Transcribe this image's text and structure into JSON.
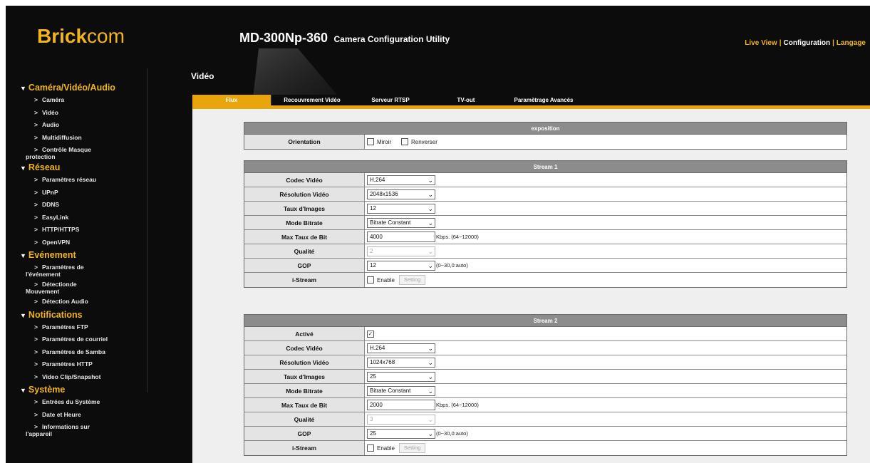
{
  "brand": {
    "logo_bold": "Brick",
    "logo_thin": "com",
    "accent": "#f2b51a"
  },
  "header": {
    "model": "MD-300Np-360",
    "subtitle": "Camera Configuration Utility",
    "nav": [
      {
        "label": "Live View",
        "active": false
      },
      {
        "label": "Configuration",
        "active": true
      },
      {
        "label": "Langage",
        "active": false
      }
    ]
  },
  "sidebar": {
    "sections": [
      {
        "title": "Caméra/Vidéo/Audio",
        "items": [
          {
            "label": "Caméra"
          },
          {
            "label": "Vidéo"
          },
          {
            "label": "Audio"
          },
          {
            "label": "Multidiffusion"
          },
          {
            "label": "Contrôle Masque",
            "cont": "protection"
          }
        ]
      },
      {
        "title": "Réseau",
        "items": [
          {
            "label": "Paramètres réseau"
          },
          {
            "label": "UPnP"
          },
          {
            "label": "DDNS"
          },
          {
            "label": "EasyLink"
          },
          {
            "label": "HTTP/HTTPS"
          },
          {
            "label": "OpenVPN"
          }
        ]
      },
      {
        "title": "Evénement",
        "items": [
          {
            "label": "Paramètres de",
            "cont": "l'événement"
          },
          {
            "label": "Détectionde",
            "cont": "Mouvement"
          },
          {
            "label": "Détection Audio"
          }
        ]
      },
      {
        "title": "Notifications",
        "items": [
          {
            "label": "Paramètres FTP"
          },
          {
            "label": "Paramètres de courriel"
          },
          {
            "label": "Paramètres de Samba"
          },
          {
            "label": "Paramètres HTTP"
          },
          {
            "label": "Video Clip/Snapshot"
          }
        ]
      },
      {
        "title": "Système",
        "items": [
          {
            "label": "Entrées du Système"
          },
          {
            "label": "Date et Heure"
          },
          {
            "label": "Informations sur",
            "cont": "l'appareil"
          }
        ]
      }
    ]
  },
  "main": {
    "title": "Vidéo",
    "tabs": [
      {
        "label": "Flux",
        "active": true
      },
      {
        "label": "Recouvrement Vidéo",
        "active": false
      },
      {
        "label": "Serveur RTSP",
        "active": false
      },
      {
        "label": "TV-out",
        "active": false
      },
      {
        "label": "Paramètrage Avancés",
        "active": false
      }
    ],
    "exposure": {
      "header": "exposition",
      "orientation_label": "Orientation",
      "mirror_label": "Miroir",
      "mirror_checked": false,
      "flip_label": "Renverser",
      "flip_checked": false
    },
    "stream1": {
      "header": "Stream 1",
      "codec_label": "Codec Vidéo",
      "codec": "H.264",
      "resolution_label": "Résolution Vidéo",
      "resolution": "2048x1536",
      "fps_label": "Taux d'Images",
      "fps": "12",
      "bitrate_mode_label": "Mode Bitrate",
      "bitrate_mode": "Bitrate Constant",
      "max_bitrate_label": "Max Taux de Bit",
      "max_bitrate": "4000",
      "max_bitrate_hint": "Kbps. (64~12000)",
      "quality_label": "Qualité",
      "quality": "2",
      "gop_label": "GOP",
      "gop": "12",
      "gop_hint": "(0~30,0:auto)",
      "istream_label": "i-Stream",
      "istream_enable_label": "Enable",
      "istream_enabled": false,
      "setting_label": "Setting"
    },
    "stream2": {
      "header": "Stream 2",
      "active_label": "Activé",
      "active_checked": true,
      "codec_label": "Codec Vidéo",
      "codec": "H.264",
      "resolution_label": "Résolution Vidéo",
      "resolution": "1024x768",
      "fps_label": "Taux d'Images",
      "fps": "25",
      "bitrate_mode_label": "Mode Bitrate",
      "bitrate_mode": "Bitrate Constant",
      "max_bitrate_label": "Max Taux de Bit",
      "max_bitrate": "2000",
      "max_bitrate_hint": "Kbps. (64~12000)",
      "quality_label": "Qualité",
      "quality": "3",
      "gop_label": "GOP",
      "gop": "25",
      "gop_hint": "(0~30,0:auto)",
      "istream_label": "i-Stream",
      "istream_enable_label": "Enable",
      "istream_enabled": false,
      "setting_label": "Setting"
    }
  }
}
